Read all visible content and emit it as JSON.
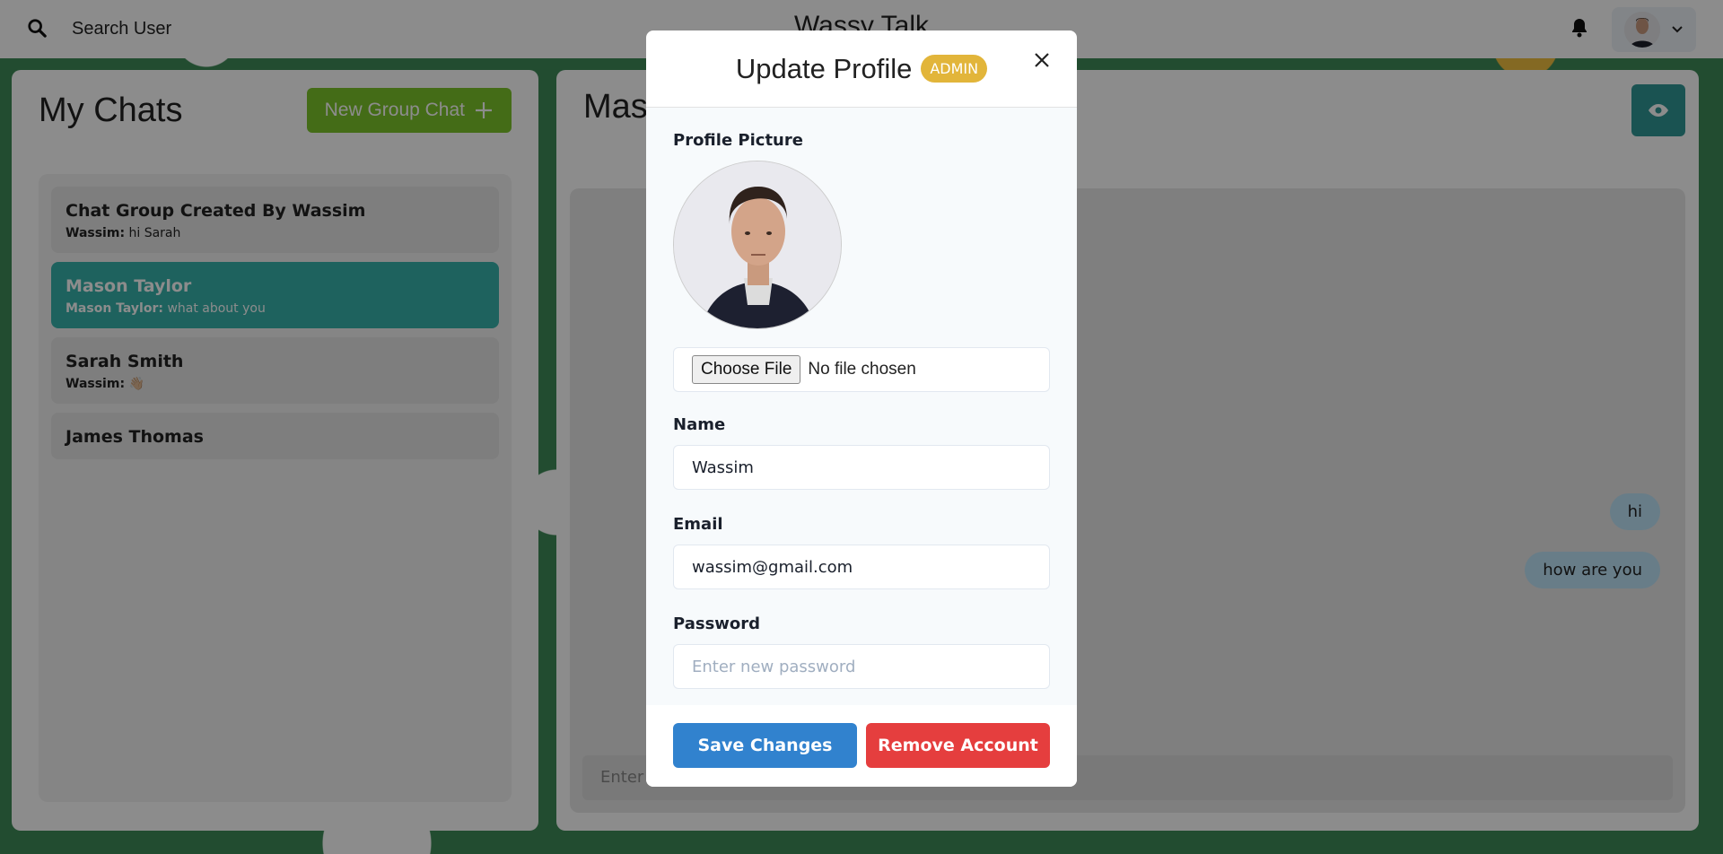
{
  "topbar": {
    "search_label": "Search User",
    "app_title": "Wassy Talk"
  },
  "left_panel": {
    "title": "My Chats",
    "new_group_label": "New Group Chat",
    "chats": [
      {
        "name": "Chat Group Created By Wassim",
        "sender": "Wassim:",
        "message": "hi Sarah"
      },
      {
        "name": "Mason Taylor",
        "sender": "Mason Taylor:",
        "message": "what about you"
      },
      {
        "name": "Sarah Smith",
        "sender": "Wassim:",
        "message": "👋🏼"
      },
      {
        "name": "James Thomas"
      }
    ]
  },
  "right_panel": {
    "title": "Mason Taylor",
    "messages": [
      "hi",
      "how are you"
    ],
    "input_placeholder": "Enter a message.."
  },
  "modal": {
    "title": "Update Profile",
    "badge": "ADMIN",
    "profile_picture_label": "Profile Picture",
    "choose_file_label": "Choose File",
    "no_file_label": "No file chosen",
    "name_label": "Name",
    "name_value": "Wassim",
    "email_label": "Email",
    "email_value": "wassim@gmail.com",
    "password_label": "Password",
    "password_placeholder": "Enter new password",
    "save_label": "Save Changes",
    "remove_label": "Remove Account"
  },
  "colors": {
    "accent_teal": "#38b2ac",
    "new_group_green": "#7cc52a",
    "save_blue": "#3182ce",
    "remove_red": "#e53e3e",
    "admin_yellow": "#e2b53a"
  },
  "icons": [
    "search-icon",
    "bell-icon",
    "chevron-down-icon",
    "plus-icon",
    "eye-icon",
    "close-icon"
  ]
}
